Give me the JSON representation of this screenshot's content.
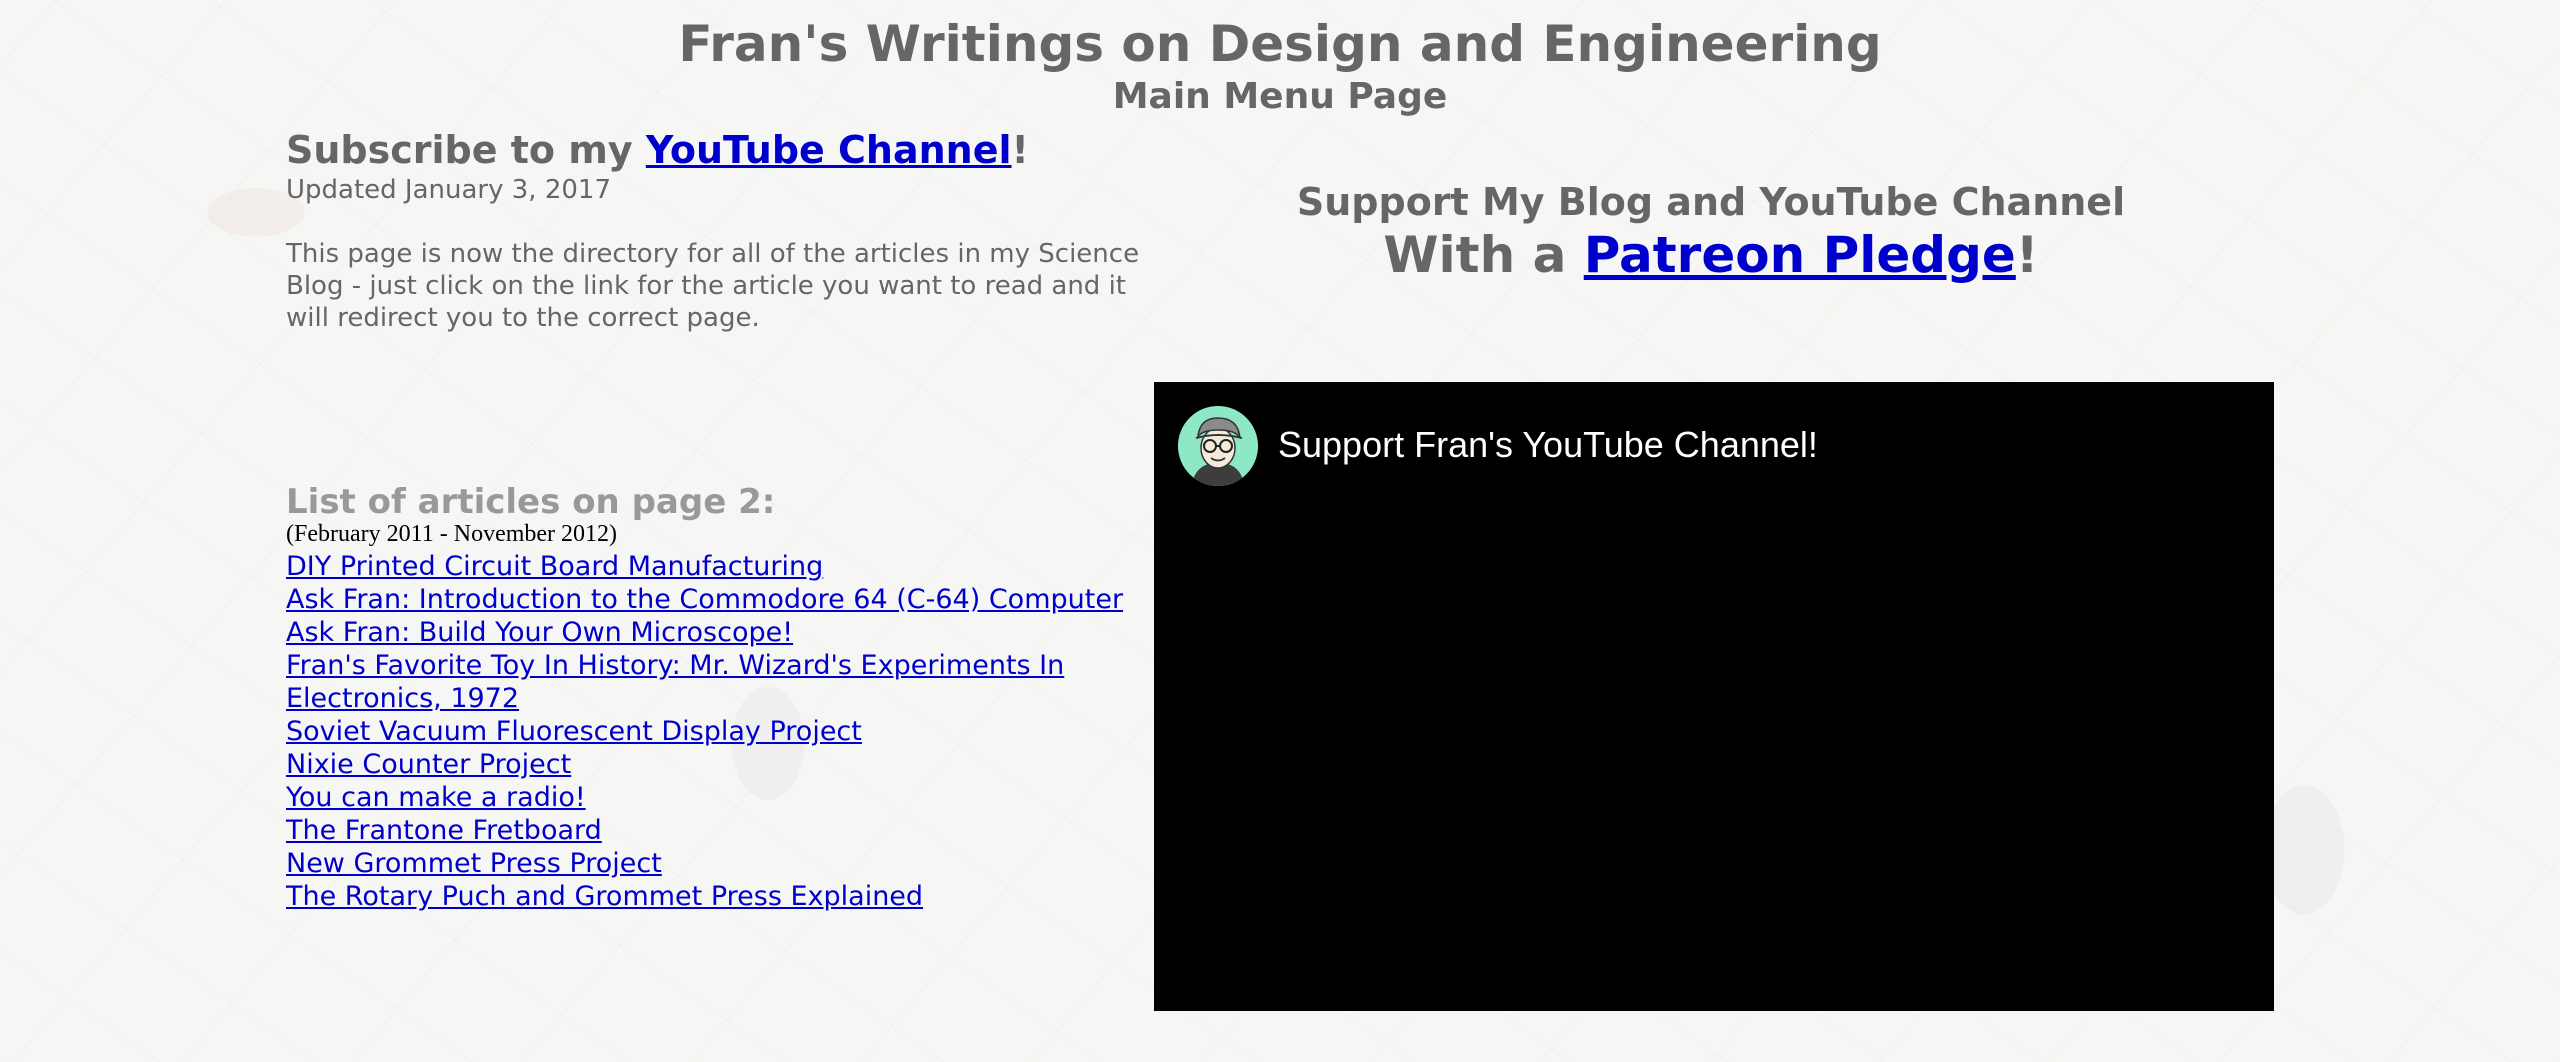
{
  "header": {
    "title": "Fran's Writings on Design and Engineering",
    "subtitle": "Main Menu Page"
  },
  "subscribe": {
    "prefix": "Subscribe to my ",
    "link_label": "YouTube Channel",
    "suffix": "!"
  },
  "updated": "Updated January 3, 2017",
  "intro": "This page is now the directory for all of the articles in my Science Blog - just click on the link for the article you want to read and it will redirect you to the correct page.",
  "articles": {
    "heading": "List of articles on page 2:",
    "date_range": "(February 2011 - November 2012)",
    "items": [
      "DIY Printed Circuit Board Manufacturing",
      "Ask Fran: Introduction to the Commodore 64 (C-64) Computer",
      "Ask Fran: Build Your Own Microscope!",
      "Fran's Favorite Toy In History: Mr. Wizard's Experiments In Electronics, 1972",
      "Soviet Vacuum Fluorescent Display Project",
      "Nixie Counter Project",
      "You can make a radio!",
      "The Frantone Fretboard",
      "New Grommet Press Project",
      "The Rotary Puch and Grommet Press Explained"
    ]
  },
  "support": {
    "line1": "Support My Blog and YouTube Channel",
    "line2_prefix": "With a ",
    "link_label": "Patreon Pledge",
    "line2_suffix": "!"
  },
  "video": {
    "title": "Support Fran's YouTube Channel!",
    "avatar_icon": "person-avatar-icon"
  },
  "colors": {
    "text_gray": "#666666",
    "heading_light_gray": "#999999",
    "link_blue": "#0000cc",
    "video_bg": "#000000",
    "avatar_bg": "#8ee8c5"
  }
}
